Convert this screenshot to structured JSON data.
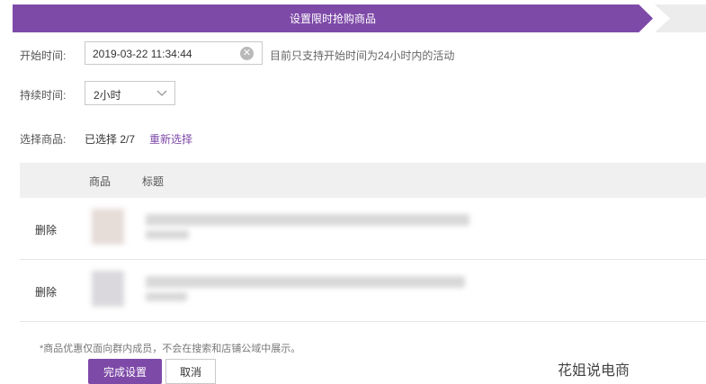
{
  "banner": {
    "title": "设置限时抢购商品"
  },
  "form": {
    "start_label": "开始时间:",
    "start_value": "2019-03-22 11:34:44",
    "start_hint": "目前只支持开始时间为24小时内的活动",
    "duration_label": "持续时间:",
    "duration_value": "2小时",
    "goods_label": "选择商品:",
    "selected_text": "已选择 2/7",
    "reselect_label": "重新选择"
  },
  "table": {
    "headers": [
      "商品",
      "标题"
    ],
    "rows": [
      {
        "action": "删除"
      },
      {
        "action": "删除"
      }
    ]
  },
  "note": "*商品优惠仅面向群内成员，不会在搜索和店铺公域中展示。",
  "buttons": {
    "confirm": "完成设置",
    "cancel": "取消"
  },
  "watermark": "花姐说电商",
  "colors": {
    "accent": "#7e4aa8"
  }
}
